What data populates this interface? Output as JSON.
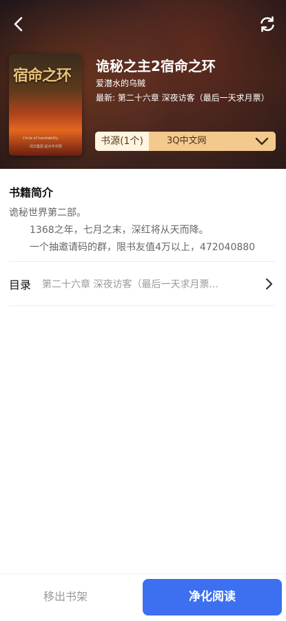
{
  "book": {
    "title": "诡秘之主2宿命之环",
    "author": "爱潜水的乌贼",
    "latest": "最新: 第二十六章 深夜访客（最后一天求月票）",
    "cover": {
      "title": "宿命之环",
      "subtitle": "Circle of Inevitability",
      "publisher": "阅文集团  起点中文网"
    }
  },
  "source": {
    "label": "书源(1个)",
    "name": "3Q中文网"
  },
  "intro": {
    "heading": "书籍简介",
    "lines": [
      "诡秘世界第二部。",
      "1368之年，七月之末，深红将从天而降。",
      "一个抽邀请码的群，限书友值4万以上，472040880"
    ]
  },
  "toc": {
    "label": "目录",
    "value": "第二十六章 深夜访客（最后一天求月票..."
  },
  "actions": {
    "remove": "移出书架",
    "read": "净化阅读"
  },
  "icons": {
    "back": "chevron-left-icon",
    "refresh": "refresh-icon",
    "source_expand": "chevron-down-icon",
    "toc_open": "chevron-right-icon"
  },
  "colors": {
    "accent": "#3d70f0",
    "source_bg": "#f3c98d"
  }
}
